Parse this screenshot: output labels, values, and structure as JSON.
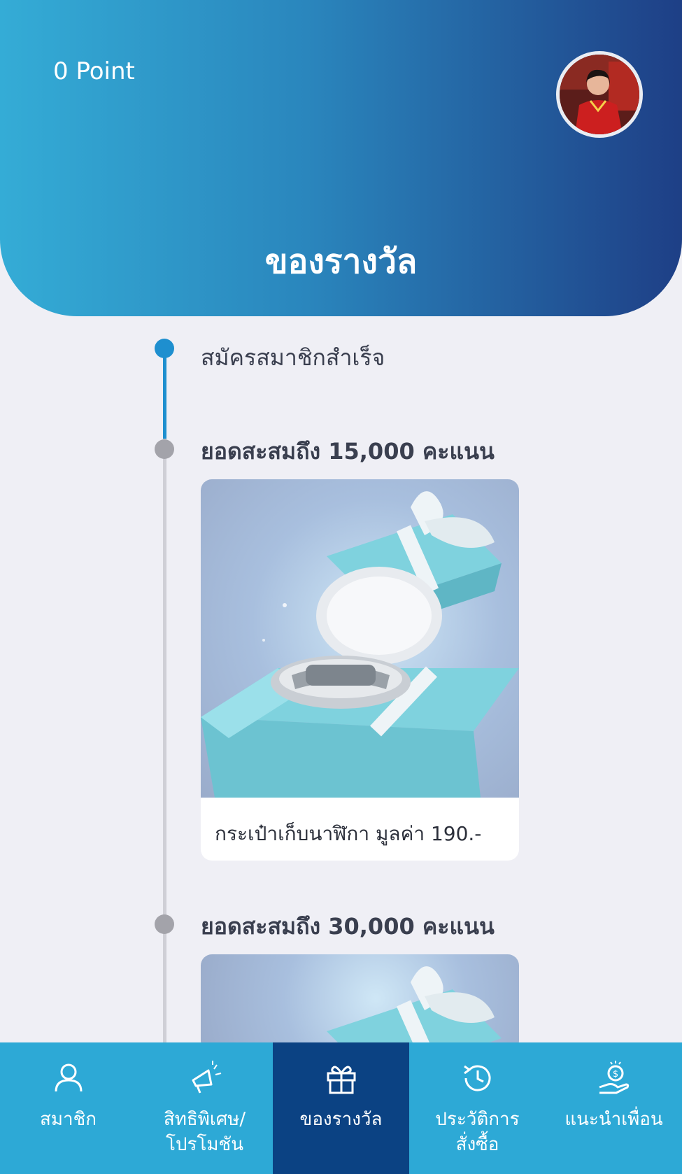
{
  "header": {
    "points": "0 Point",
    "title": "ของรางวัล"
  },
  "timeline": [
    {
      "label": "สมัครสมาชิกสำเร็จ",
      "status": "completed"
    },
    {
      "label": "ยอดสะสมถึง 15,000 คะแนน",
      "status": "pending",
      "reward": {
        "caption": "กระเป๋าเก็บนาฬิกา มูลค่า 190.-"
      }
    },
    {
      "label": "ยอดสะสมถึง 30,000 คะแนน",
      "status": "pending"
    }
  ],
  "bottom_nav": [
    {
      "label": "สมาชิก",
      "icon": "user-icon"
    },
    {
      "label": "สิทธิพิเศษ/\nโปรโมชัน",
      "icon": "megaphone-icon"
    },
    {
      "label": "ของรางวัล",
      "icon": "gift-icon",
      "active": true
    },
    {
      "label": "ประวัติการ\nสั่งซื้อ",
      "icon": "history-icon"
    },
    {
      "label": "แนะนำเพื่อน",
      "icon": "money-hand-icon"
    }
  ],
  "colors": {
    "header_start": "#34acd6",
    "header_end": "#1e3f86",
    "timeline_active": "#1e8fcf",
    "timeline_inactive": "#a3a3aa",
    "nav_bg": "#2da9d6",
    "nav_active": "#0b4283"
  }
}
